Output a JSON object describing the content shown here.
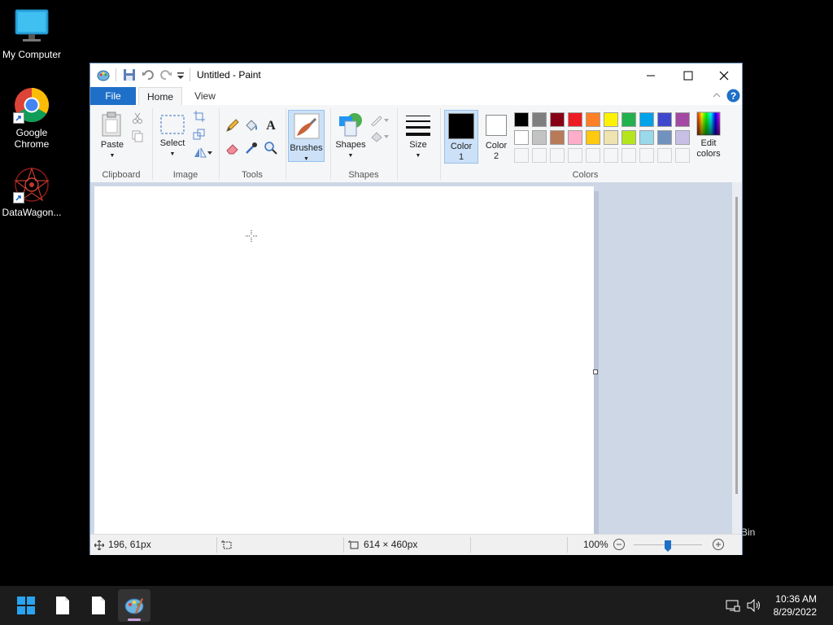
{
  "desktop": {
    "icons": [
      {
        "label": "My Computer"
      },
      {
        "label": "Google Chrome"
      },
      {
        "label": "DataWagon..."
      }
    ],
    "recycle_bin_fragment": "Bin"
  },
  "window": {
    "title": "Untitled - Paint",
    "menu": {
      "file": "File",
      "home": "Home",
      "view": "View"
    },
    "ribbon": {
      "clipboard": {
        "paste": "Paste",
        "label": "Clipboard"
      },
      "image": {
        "select": "Select",
        "label": "Image"
      },
      "tools": {
        "label": "Tools"
      },
      "brushes": {
        "label": "Brushes"
      },
      "shapes": {
        "shapes": "Shapes",
        "label": "Shapes"
      },
      "size": {
        "label": "Size"
      },
      "colors": {
        "color1": "Color 1",
        "color2": "Color 2",
        "edit": "Edit colors",
        "label": "Colors",
        "color1_value": "#000000",
        "color2_value": "#ffffff",
        "palette_row1": [
          "#000000",
          "#7f7f7f",
          "#880015",
          "#ed1c24",
          "#ff7f27",
          "#fff200",
          "#22b14c",
          "#00a2e8",
          "#3f48cc",
          "#a349a4"
        ],
        "palette_row2": [
          "#ffffff",
          "#c3c3c3",
          "#b97a57",
          "#ffaec9",
          "#ffc90e",
          "#efe4b0",
          "#b5e61d",
          "#99d9ea",
          "#7092be",
          "#c8bfe7"
        ]
      }
    },
    "status": {
      "cursor_pos": "196, 61px",
      "canvas_size": "614 × 460px",
      "zoom": "100%"
    }
  },
  "taskbar": {
    "time": "10:36 AM",
    "date": "8/29/2022"
  },
  "colors": {
    "accent": "#1e6fc8"
  }
}
